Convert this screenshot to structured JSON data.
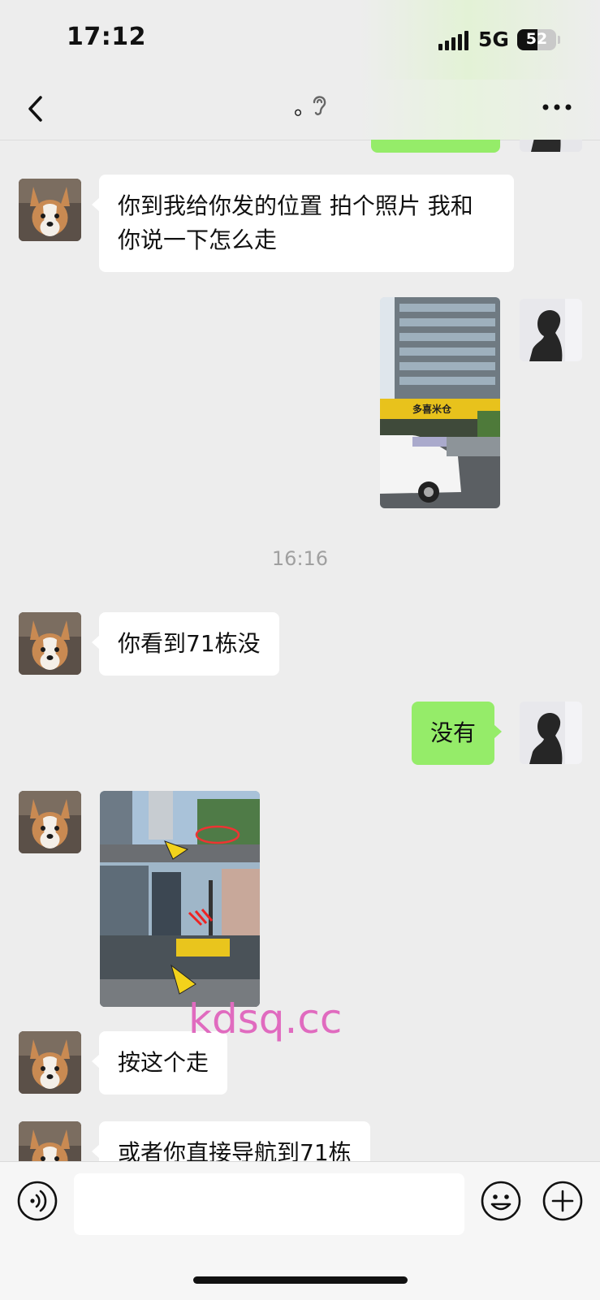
{
  "status_bar": {
    "time": "17:12",
    "network": "5G",
    "battery": "52"
  },
  "nav": {
    "title": "。"
  },
  "messages": {
    "m1": "你到我给你发的位置 拍个照片 我和你说一下怎么走",
    "timestamp": "16:16",
    "m2": "你看到71栋没",
    "m3": "没有",
    "m4": "按这个走",
    "m5": "或者你直接导航到71栋"
  },
  "photo_signs": {
    "store": "多喜米仓"
  },
  "watermark": "kdsq.cc",
  "icons": [
    "back-icon",
    "ear-icon",
    "more-icon",
    "voice-icon",
    "emoji-icon",
    "plus-icon"
  ]
}
